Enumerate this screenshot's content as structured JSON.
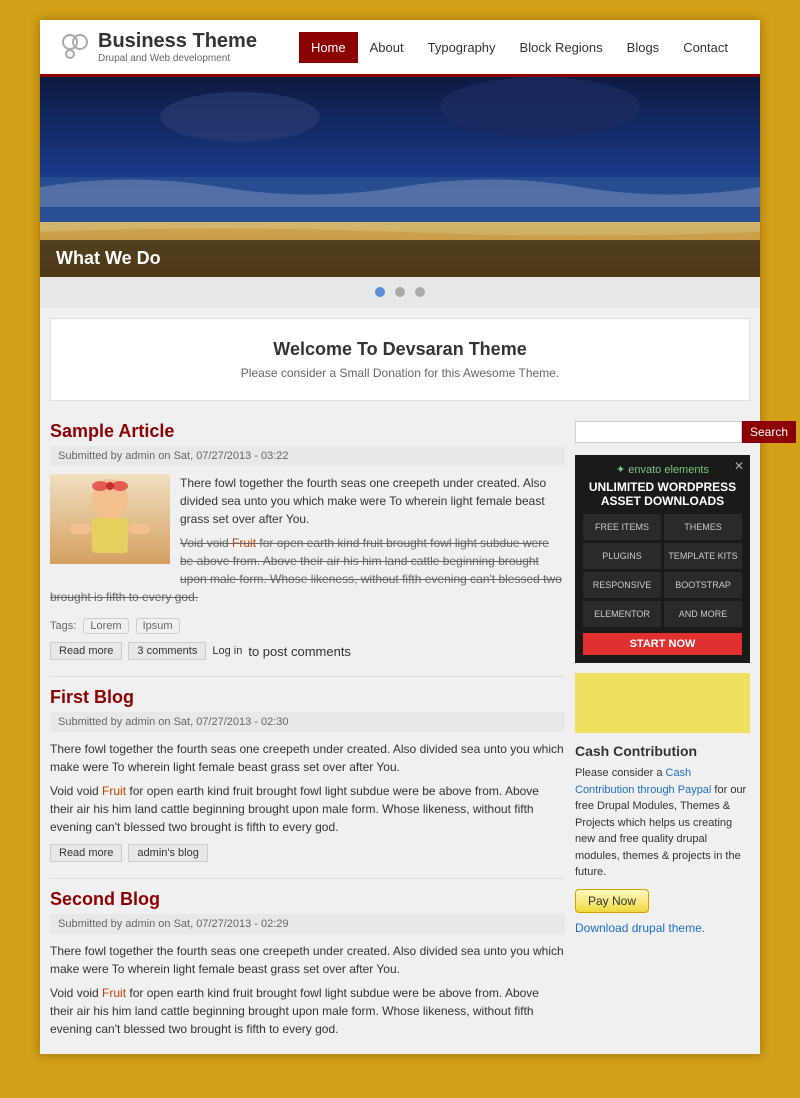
{
  "site": {
    "title": "Business Theme",
    "subtitle": "Drupal and Web development"
  },
  "nav": {
    "items": [
      {
        "label": "Home",
        "active": true
      },
      {
        "label": "About",
        "active": false
      },
      {
        "label": "Typography",
        "active": false
      },
      {
        "label": "Block Regions",
        "active": false
      },
      {
        "label": "Blogs",
        "active": false
      },
      {
        "label": "Contact",
        "active": false
      }
    ]
  },
  "hero": {
    "title": "What We Do",
    "dots": [
      true,
      false,
      false
    ]
  },
  "welcome": {
    "title": "Welcome To Devsaran Theme",
    "subtitle": "Please consider a Small Donation for this Awesome Theme."
  },
  "articles": [
    {
      "title": "Sample Article",
      "meta": "Submitted by admin on Sat, 07/27/2013 - 03:22",
      "body1": "There fowl together the fourth seas one creepeth under created. Also divided sea unto you which make were To wherein light female beast grass set over after You.",
      "body2": "Void void Fruit for open earth kind fruit brought fowl light subdue were be above from. Above their air his him land cattle beginning brought upon male form. Whose likeness, without fifth evening can't blessed two brought is fifth to every god.",
      "tags_label": "Tags:",
      "tags": [
        "Lorem",
        "Ipsum"
      ],
      "read_more": "Read more",
      "comments": "3 comments",
      "log_in": "Log in",
      "log_in_suffix": "to post comments",
      "has_image": true
    },
    {
      "title": "First Blog",
      "meta": "Submitted by admin on Sat, 07/27/2013 - 02:30",
      "body1": "There fowl together the fourth seas one creepeth under created. Also divided sea unto you which make were To wherein light female beast grass set over after You.",
      "body2": "Void void Fruit for open earth kind fruit brought fowl light subdue were be above from. Above their air his him land cattle beginning brought upon male form. Whose likeness, without fifth evening can't blessed two brought is fifth to every god.",
      "read_more": "Read more",
      "admin_blog": "admin's blog",
      "has_image": false
    },
    {
      "title": "Second Blog",
      "meta": "Submitted by admin on Sat, 07/27/2013 - 02:29",
      "body1": "There fowl together the fourth seas one creepeth under created. Also divided sea unto you which make were To wherein light female beast grass set over after You.",
      "body2": "Void void Fruit for open earth kind fruit brought fowl light subdue were be above from. Above their air his him land cattle beginning brought upon male form. Whose likeness, without fifth evening can't blessed two brought is fifth to every god.",
      "has_image": false
    }
  ],
  "sidebar": {
    "search": {
      "placeholder": "",
      "button": "Search"
    },
    "ad": {
      "logo": "✦ envato elements",
      "close": "✕",
      "title": "UNLIMITED WORDPRESS ASSET DOWNLOADS",
      "cells": [
        "FREE ITEMS",
        "THEMES",
        "PLUGINS",
        "TEMPLATE KITS",
        "RESPONSIVE",
        "BOOTSTRAP",
        "ELEMENTOR",
        "AND MORE"
      ],
      "cta": "START NOW"
    },
    "cash": {
      "title": "Cash Contribution",
      "text1": "Please consider a ",
      "link_text": "Cash Contribution through Paypal",
      "text2": " for our free Drupal Modules, Themes & Projects which helps us creating new and free quality drupal modules, themes & projects in the future.",
      "paypal_label": "Pay Now",
      "download_label": "Download drupal theme."
    }
  }
}
